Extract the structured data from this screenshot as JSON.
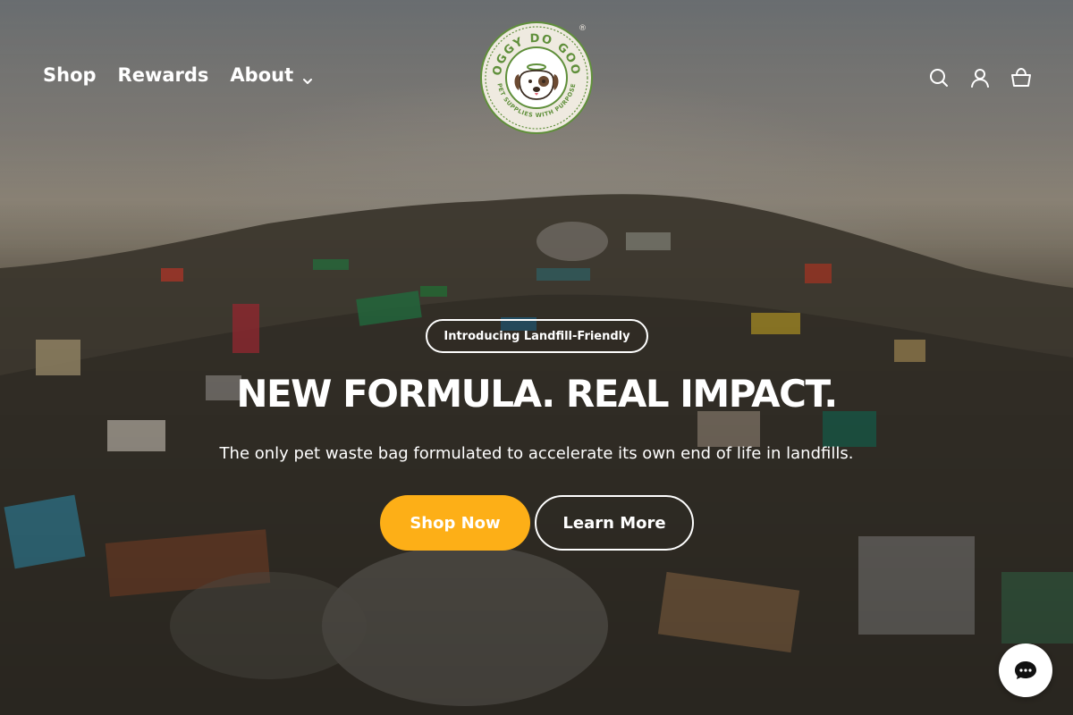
{
  "header": {
    "nav": [
      {
        "label": "Shop"
      },
      {
        "label": "Rewards"
      },
      {
        "label": "About"
      }
    ],
    "logo": {
      "top_text": "DOGGY DO GOOD",
      "bottom_text": "PET SUPPLIES WITH PURPOSE",
      "registered_mark": "®"
    },
    "icons": [
      "search-icon",
      "account-icon",
      "cart-icon"
    ]
  },
  "hero": {
    "pill": "Introducing Landfill-Friendly",
    "headline": "NEW FORMULA. REAL IMPACT.",
    "subtext": "The only pet waste bag formulated to accelerate its own end of life in landfills.",
    "primary_button": "Shop Now",
    "secondary_button": "Learn More"
  },
  "chat": {
    "icon": "chat-bubble-icon"
  },
  "colors": {
    "accent": "#fdaf17",
    "logo_green": "#5f8f3a",
    "text": "#ffffff"
  }
}
